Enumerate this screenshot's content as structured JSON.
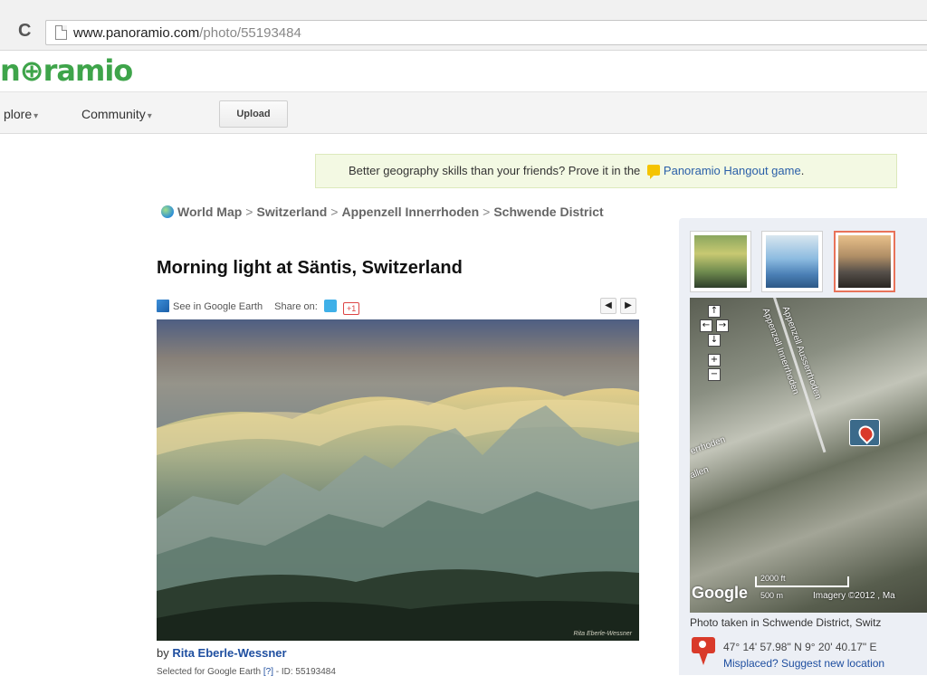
{
  "browser": {
    "url_host": "www.panoramio.com",
    "url_path": "/photo/55193484",
    "reload_glyph": "C"
  },
  "header": {
    "logo_text": "n⊕ramio",
    "nav": {
      "explore": "plore",
      "community": "Community",
      "caret": "▾",
      "upload": "Upload"
    }
  },
  "promo": {
    "text": "Better geography skills than your friends? Prove it in the",
    "link": "Panoramio Hangout game",
    "end": "."
  },
  "breadcrumb": {
    "items": [
      "World Map",
      "Switzerland",
      "Appenzell Innerrhoden",
      "Schwende District"
    ],
    "separator": ">"
  },
  "photo": {
    "title": "Morning light at Säntis, Switzerland",
    "see_in_google_earth": "See in Google Earth",
    "share_on": "Share on:",
    "gplus": "+1",
    "prev": "◀",
    "next": "▶",
    "signature": "Rita Eberle-Wessner",
    "author_prefix": "by",
    "author": "Rita Eberle-Wessner",
    "selected_prefix": "Selected for Google Earth",
    "help": "[?]",
    "id_text": "- ID: 55193484"
  },
  "side": {
    "map": {
      "controls": {
        "up": "↑",
        "left": "←",
        "right": "→",
        "down": "↓",
        "plus": "+",
        "minus": "−"
      },
      "labels": [
        "Appenzell Innerrhoden",
        "Appenzell Ausserrhoden",
        "errhoden",
        "allen"
      ],
      "google": "Google",
      "scale_ft": "2000 ft",
      "scale_m": "500 m",
      "imagery": "Imagery ©2012 , Ma"
    },
    "taken_in": "Photo taken in Schwende District, Switz",
    "coords": "47° 14' 57.98\" N  9° 20' 40.17\" E",
    "misplaced": "Misplaced? Suggest new location"
  },
  "colors": {
    "brand_green": "#3ea44a",
    "link_blue": "#1f4fa0",
    "marker_red": "#d93a2a"
  }
}
